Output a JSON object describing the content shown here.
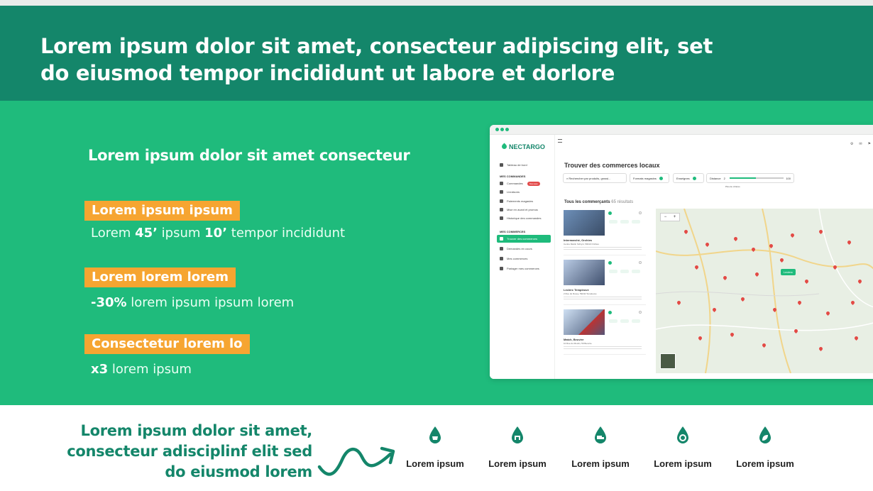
{
  "header": {
    "title": "Lorem ipsum dolor sit amet, consecteur adipiscing elit, set do eiusmod tempor incididunt ut labore et dorlore"
  },
  "band": {
    "subtitle": "Lorem ipsum dolor sit amet consecteur",
    "stats": [
      {
        "label": "Lorem ipsum ipsum",
        "pre": "Lorem ",
        "v1": "45’",
        "mid": " ipsum ",
        "v2": "10’",
        "post": " tempor incididunt"
      },
      {
        "label": "Lorem lorem lorem",
        "v1": "-30%",
        "post": " lorem ipsum ipsum lorem"
      },
      {
        "label": "Consectetur lorem lo",
        "v1": "x3",
        "post": " lorem ipsum"
      }
    ]
  },
  "app": {
    "brand": "NECTARGO",
    "sidebar": {
      "dashboard": "Tableau de bord",
      "section_orders": "MES COMMANDES",
      "orders_items": [
        "Commandes",
        "Livraisons",
        "Paiements magasins",
        "Mise en avant et promos",
        "Historique des commandes"
      ],
      "orders_badge": "Nouveau",
      "section_shops": "MES COMMERCES",
      "shops_items": [
        "Trouver des commerces",
        "Demandes en cours",
        "Mes commerces",
        "Partager mes commerces"
      ]
    },
    "main_title": "Trouver des commerces locaux",
    "filters": {
      "search_placeholder": "Rechercher par produits, grossi...",
      "format": "Formats magasins",
      "brands": "Enseignes",
      "distance": "Distance",
      "distance_min": "2",
      "distance_value": "50km",
      "distance_max": "100",
      "distance_note": "Plus de critères",
      "distance_fraction": 0.48
    },
    "results_title": "Tous les commerçants",
    "results_count": "65 résultats",
    "cards": [
      {
        "name": "Intermarché, Orchies",
        "address": "Centre Martin Schiyvt, 59310 Orchies"
      },
      {
        "name": "Leclerc Templeuve",
        "address": "2 Rue du Rosoy, 59242 Templeuve"
      },
      {
        "name": "Match, Beuvire",
        "address": "10 Rue du Moulin, 59 Beuvire"
      }
    ],
    "map": {
      "zoom_in": "+",
      "zoom_out": "−",
      "highlight": "Leclerc"
    }
  },
  "footer": {
    "tagline": "Lorem ipsum dolor sit amet, consecteur adisciplinf elit sed do eiusmod lorem",
    "features": [
      {
        "label": "Lorem ipsum",
        "icon": "drop-basket-icon"
      },
      {
        "label": "Lorem ipsum",
        "icon": "drop-store-icon"
      },
      {
        "label": "Lorem ipsum",
        "icon": "drop-truck-icon"
      },
      {
        "label": "Lorem ipsum",
        "icon": "drop-gear-icon"
      },
      {
        "label": "Lorem ipsum",
        "icon": "drop-leaf-icon"
      }
    ]
  },
  "colors": {
    "header": "#14866a",
    "band": "#1fbb7c",
    "accent": "#f6a531",
    "text_dark": "#222222"
  }
}
